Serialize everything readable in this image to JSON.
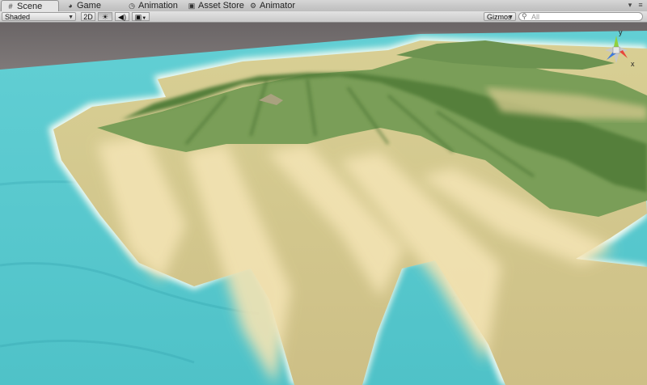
{
  "tabs": [
    {
      "label": "Scene",
      "icon": "grid-icon",
      "active": true
    },
    {
      "label": "Game",
      "icon": "pacman-icon",
      "active": false
    },
    {
      "label": "Animation",
      "icon": "clock-icon",
      "active": false
    },
    {
      "label": "Asset Store",
      "icon": "bag-icon",
      "active": false
    },
    {
      "label": "Animator",
      "icon": "animator-icon",
      "active": false
    }
  ],
  "toolbar": {
    "draw_mode": "Shaded",
    "mode_2d": "2D",
    "lighting_icon": "sun-icon",
    "audio_icon": "speaker-icon",
    "effects_icon": "image-icon",
    "gizmos_label": "Gizmos",
    "search_placeholder": "All",
    "search_icon": "search-icon"
  },
  "gizmo": {
    "y_label": "y",
    "x_label": "x",
    "colors": {
      "y": "#8fd13f",
      "x": "#e8463a",
      "z": "#3c78e0",
      "neutral": "#c8c8c8"
    }
  },
  "scene": {
    "colors": {
      "sky": "#6f6a6a",
      "water": "#5ccad0",
      "water_deep": "#3aa6b2",
      "foam": "#eaf9f4",
      "sand": "#d8cf94",
      "sand_light": "#f1e2b2",
      "grass": "#7a9e58",
      "grass_dark": "#4f7a36"
    }
  }
}
